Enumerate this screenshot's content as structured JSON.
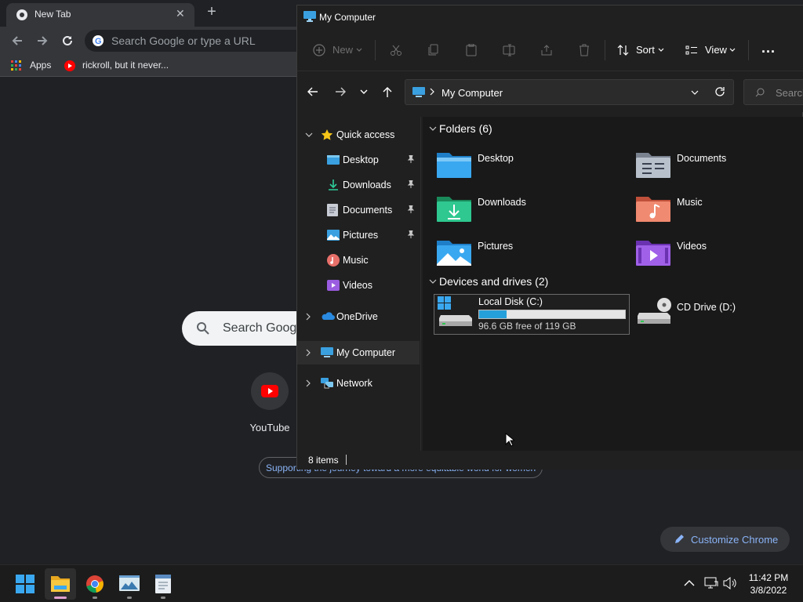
{
  "chrome": {
    "tab_title": "New Tab",
    "tab_close": "✕",
    "new_tab": "+",
    "omnibox_placeholder": "Search Google or type a URL",
    "bookmarks": [
      {
        "label": "Apps",
        "icon": "apps-grid-icon"
      },
      {
        "label": "rickroll, but it never...",
        "icon": "youtube-icon"
      }
    ],
    "ntp": {
      "search_placeholder": "Search Googl",
      "shortcut_label": "YouTube",
      "promo_text": "Supporting the journey toward a more equitable world for women",
      "customize_label": "Customize Chrome"
    }
  },
  "explorer": {
    "title": "My Computer",
    "commands": {
      "new_label": "New",
      "sort_label": "Sort",
      "view_label": "View",
      "more_label": "..."
    },
    "address": {
      "path": "My Computer",
      "search_placeholder": "Search"
    },
    "nav": [
      {
        "label": "Quick access",
        "icon": "star-icon",
        "expanded": true
      },
      {
        "label": "Desktop",
        "icon": "desktop-folder-icon",
        "pinned": true
      },
      {
        "label": "Downloads",
        "icon": "download-icon",
        "pinned": true
      },
      {
        "label": "Documents",
        "icon": "documents-icon",
        "pinned": true
      },
      {
        "label": "Pictures",
        "icon": "pictures-icon",
        "pinned": true
      },
      {
        "label": "Music",
        "icon": "music-icon"
      },
      {
        "label": "Videos",
        "icon": "videos-icon"
      },
      {
        "label": "OneDrive",
        "icon": "onedrive-cloud-icon"
      },
      {
        "label": "My Computer",
        "icon": "computer-icon",
        "selected": true
      },
      {
        "label": "Network",
        "icon": "network-icon"
      }
    ],
    "folders_header": "Folders (6)",
    "folders": [
      {
        "label": "Desktop",
        "icon": "desktop-folder-icon"
      },
      {
        "label": "Documents",
        "icon": "documents-folder-icon"
      },
      {
        "label": "Downloads",
        "icon": "downloads-folder-icon"
      },
      {
        "label": "Music",
        "icon": "music-folder-icon"
      },
      {
        "label": "Pictures",
        "icon": "pictures-folder-icon"
      },
      {
        "label": "Videos",
        "icon": "videos-folder-icon"
      }
    ],
    "drives_header": "Devices and drives (2)",
    "drives": [
      {
        "label": "Local Disk (C:)",
        "free_text": "96.6 GB free of 119 GB",
        "used_fraction": 0.19,
        "icon": "hard-drive-icon"
      },
      {
        "label": "CD Drive (D:)",
        "icon": "cd-drive-icon"
      }
    ],
    "status": "8 items"
  },
  "taskbar": {
    "time": "11:42 PM",
    "date": "3/8/2022",
    "apps": [
      {
        "name": "start-button",
        "icon": "windows-logo-icon"
      },
      {
        "name": "file-explorer",
        "icon": "folder-icon",
        "active": true
      },
      {
        "name": "chrome",
        "icon": "chrome-icon"
      },
      {
        "name": "photos-app",
        "icon": "photos-icon"
      },
      {
        "name": "document-app",
        "icon": "document-icon"
      }
    ]
  },
  "colors": {
    "accent": "#26a0da",
    "selection": "#2d2d2d"
  }
}
